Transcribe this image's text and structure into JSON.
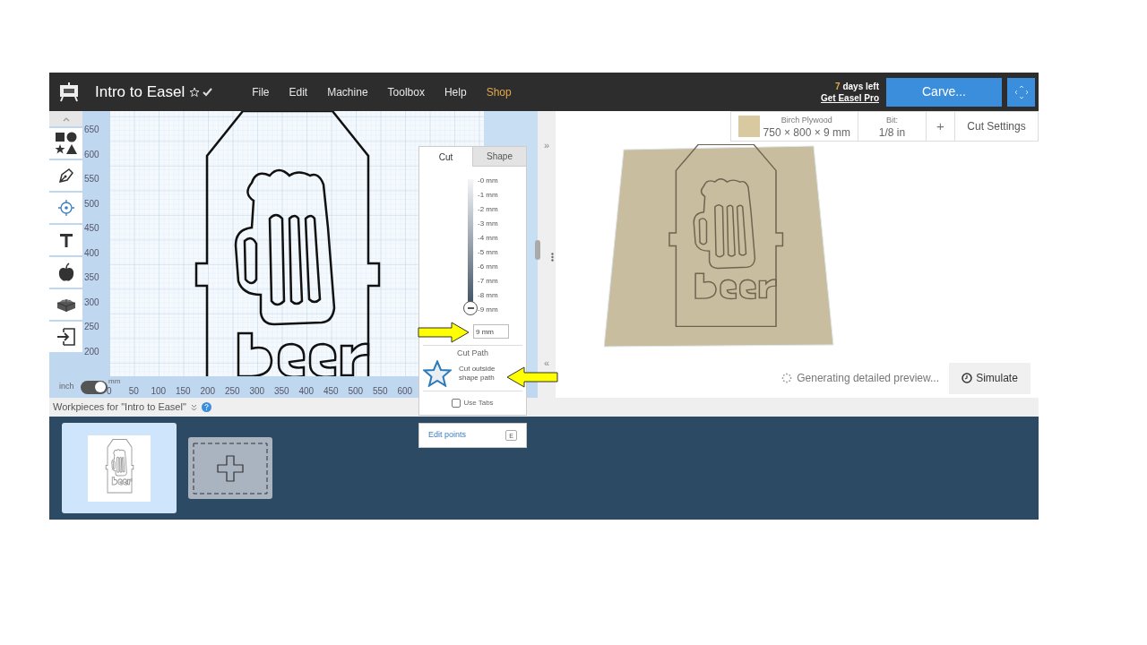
{
  "app_bar": {
    "title": "Intro to Easel",
    "menu": [
      {
        "label": "File",
        "kind": "plain"
      },
      {
        "label": "Edit",
        "kind": "plain"
      },
      {
        "label": "Machine",
        "kind": "plain"
      },
      {
        "label": "Toolbox",
        "kind": "plain"
      },
      {
        "label": "Help",
        "kind": "plain"
      },
      {
        "label": "Shop",
        "kind": "highlight"
      }
    ],
    "trial": {
      "count": "7",
      "text": "days left",
      "link": "Get Easel Pro"
    },
    "carve_button": "Carve..."
  },
  "canvas": {
    "y_ruler": [
      "650",
      "600",
      "550",
      "500",
      "450",
      "400",
      "350",
      "300",
      "250",
      "200"
    ],
    "x_ruler": [
      "0",
      "50",
      "100",
      "150",
      "200",
      "250",
      "300",
      "350",
      "400",
      "450",
      "500",
      "550",
      "600"
    ],
    "units": {
      "left": "inch",
      "right": "mm",
      "on": true
    },
    "side_toggles": {
      "expand": "»",
      "collapse": "«"
    }
  },
  "cut_panel": {
    "tabs": [
      {
        "label": "Cut",
        "selected": true
      },
      {
        "label": "Shape",
        "selected": false
      }
    ],
    "depth_ticks": [
      "-0 mm",
      "-1 mm",
      "-2 mm",
      "-3 mm",
      "-4 mm",
      "-5 mm",
      "-6 mm",
      "-7 mm",
      "-8 mm",
      "-9 mm"
    ],
    "depth": {
      "level": 1,
      "value": "9 mm"
    },
    "cut_path": {
      "heading": "Cut Path",
      "label": "Cut outside shape path"
    },
    "use_tabs": {
      "label": "Use Tabs",
      "checked": false
    },
    "edit_points": {
      "label": "Edit points",
      "key": "E"
    }
  },
  "material_bar": {
    "material": "Birch Plywood",
    "size": "750 × 800 × 9 mm",
    "bit_label": "Bit:",
    "bit": "1/8 in",
    "add": "+",
    "settings": "Cut Settings"
  },
  "preview": {
    "status": "Generating detailed preview...",
    "simulate": "Simulate"
  },
  "workpieces": {
    "heading": "Workpieces for \"Intro to Easel\"",
    "items": [
      {
        "kind": "design",
        "selected": true
      },
      {
        "kind": "add",
        "selected": false
      }
    ]
  }
}
